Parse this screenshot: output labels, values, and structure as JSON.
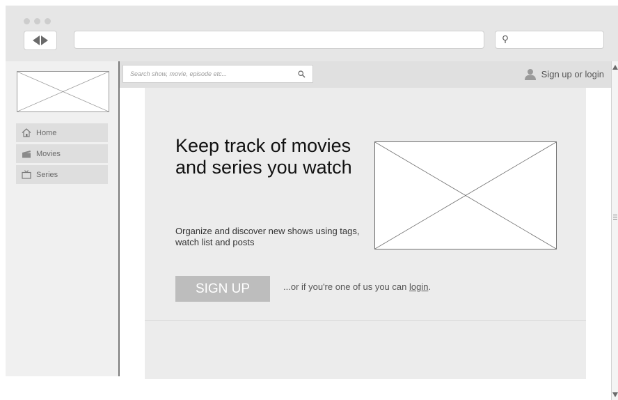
{
  "browser": {
    "address_value": "",
    "search_value": ""
  },
  "sidebar": {
    "items": [
      {
        "label": "Home",
        "icon": "home-icon"
      },
      {
        "label": "Movies",
        "icon": "film-clapper-icon"
      },
      {
        "label": "Series",
        "icon": "tv-icon"
      }
    ]
  },
  "topbar": {
    "search_placeholder": "Search show, movie, episode etc...",
    "signup_label": "Sign up or login"
  },
  "hero": {
    "title": "Keep track of movies and series you watch",
    "subtitle": "Organize and discover new shows using tags, watch list and posts",
    "signup_button": "SIGN UP",
    "login_prefix": "...or if you're one of us you can ",
    "login_link": "login",
    "login_suffix": "."
  },
  "colors": {
    "chrome": "#e6e6e6",
    "hero_bg": "#ececec",
    "button": "#bdbdbd",
    "nav_item": "#dedede"
  }
}
